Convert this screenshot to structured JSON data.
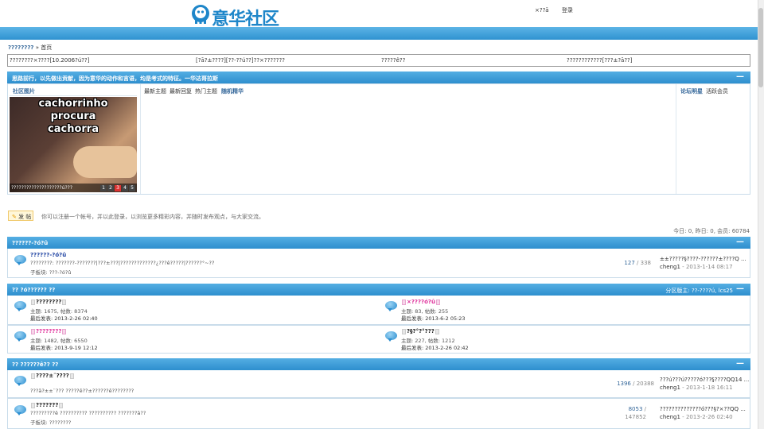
{
  "header": {
    "logo_text": "意华社区",
    "top_links": [
      "×??ā",
      "登录"
    ]
  },
  "breadcrumb": {
    "home": "????????",
    "sep": "»",
    "current": "首页"
  },
  "announcements": [
    "????????×????[10.2006?ú??]",
    "[?ā?±????][??-??ú??]??×???????",
    "?????ê??",
    "????????????[???±?ā??]"
  ],
  "featured": {
    "bar_text": "思路前行，以先做出贡献，因为意华的动作和言语，均是考式的特征。一华达哥拉斯",
    "collapse": "—",
    "left_tab": "社区图片",
    "photo_lines": [
      "cachorrinho",
      "procura",
      "cachorra"
    ],
    "photo_caption": "????????????????????ú???",
    "pager": [
      "1",
      "2",
      "3",
      "4",
      "5"
    ],
    "tabs": [
      "最新主题",
      "最新回复",
      "热门主题",
      "随机精华"
    ],
    "right_tabs": [
      "论坛明星",
      "活跃会员"
    ]
  },
  "post_button": "发 帖",
  "invite_text": "你可以注册一个帐号，并以此登录，以浏览更多精彩内容，并随时发布观点，与大家交流。",
  "stats_text": "今日: 0, 昨日: 0, 会员: 60784",
  "sections": [
    {
      "title": "??????-?ó?û",
      "collapse": "—",
      "forums": [
        {
          "name": "??????-?ó?û",
          "desc": "????????: ???????-???????|???±???|?????????????¿???ê?????|??????°~??",
          "sub": "子板块: ???-?ó?û",
          "threads": "127",
          "posts": "338",
          "last_title": "±±?????§????-??????±????Q ...",
          "last_user": "cheng1",
          "last_date": "2013-1-14 08:17"
        }
      ]
    },
    {
      "title": "?? ?ó?????? ??",
      "moderator": "分区版主: ??-????ú, lcs25",
      "collapse": "—",
      "grid": [
        {
          "name": "????????",
          "topics": "主题: 1675, 帖数: 8374",
          "last": "最后发表: 2013-2-26 02:40"
        },
        {
          "name": "×????ó?û",
          "topics": "主题: 83, 帖数: 255",
          "last": "最后发表: 2013-6-2 05:23"
        },
        {
          "name": "????????",
          "topics": "主题: 1482, 帖数: 6550",
          "last": "最后发表: 2013-9-19 12:12"
        },
        {
          "name": "?§?°?°???",
          "topics": "主题: 227, 帖数: 1212",
          "last": "最后发表: 2013-2-26 02:42"
        }
      ]
    },
    {
      "title": "?? ??????ê?? ??",
      "collapse": "—",
      "forums": [
        {
          "name": "????±¨????",
          "desc": "???ā?±±¨??? ?????ê??±??????ê????????",
          "sub": "",
          "threads": "1396",
          "posts": "20388",
          "last_title": "???ú???ú?????ó???§????QQ14 ...",
          "last_user": "cheng1",
          "last_date": "2013-1-18 16:11"
        },
        {
          "name": "???????",
          "desc": "?????????ê ?????????? ?????????? ???????ā??",
          "sub": "子板块: ????????",
          "threads": "8053",
          "posts": "147852",
          "last_title": "??????????????ó???§?×??QQ ...",
          "last_user": "cheng1",
          "last_date": "2013-2-26 02:40"
        }
      ]
    }
  ],
  "colors": {
    "accent": "#2f92d0",
    "link": "#336699",
    "pink": "#e0309b",
    "navy": "#1a3fa0"
  },
  "icons": [
    "forum-bubble-icon",
    "pencil-icon",
    "collapse-icon"
  ]
}
